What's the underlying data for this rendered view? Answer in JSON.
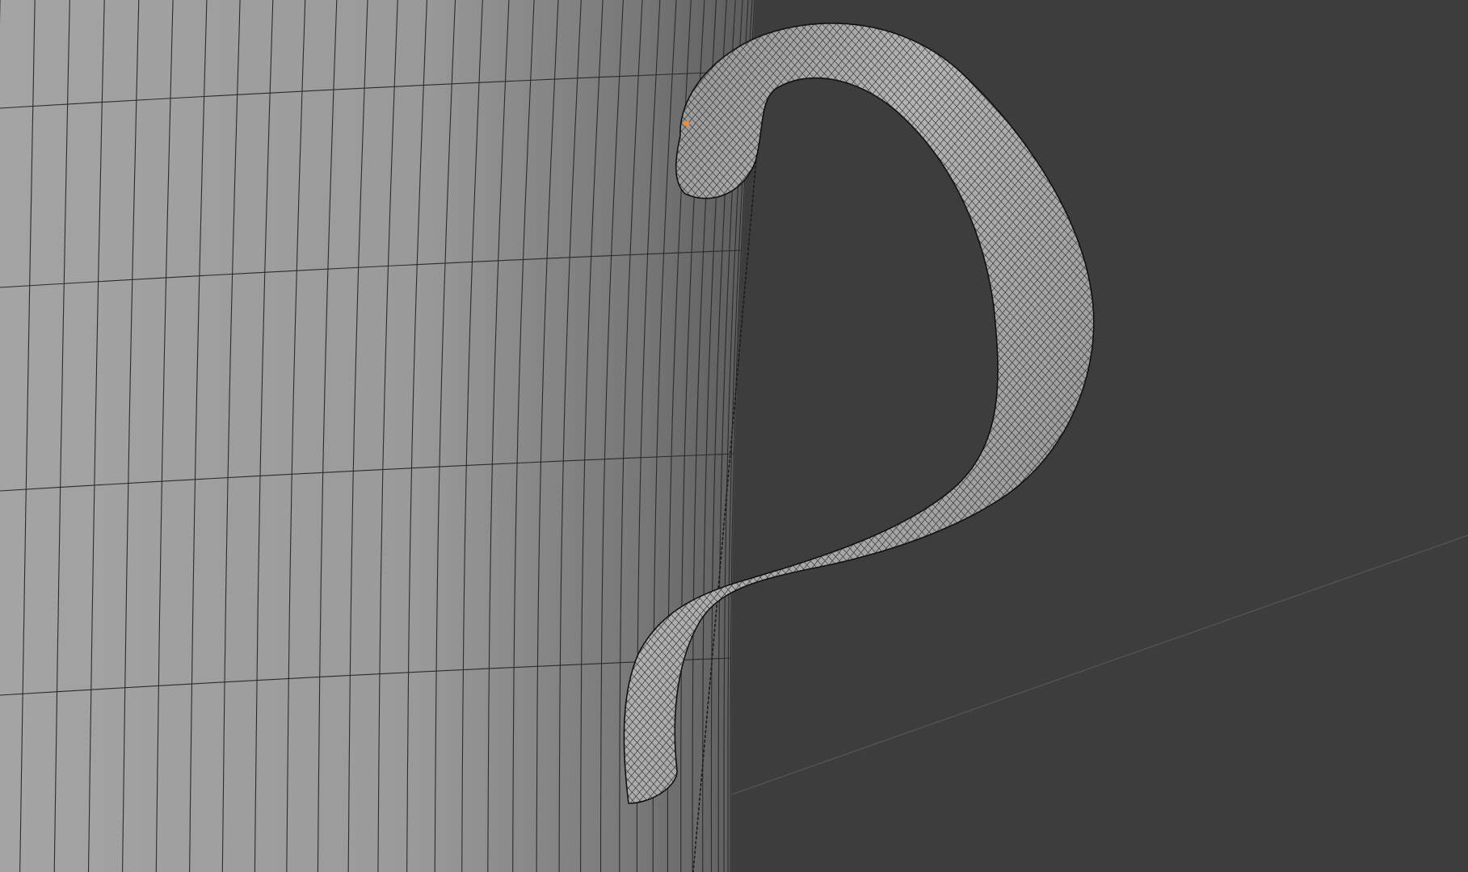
{
  "viewport": {
    "background_color": "#3d3d3d",
    "grid_line_color": "#565656"
  },
  "mug_body": {
    "fill_light": "#a7a7a7",
    "fill_shadow": "#5c5c5c",
    "wire_color": "#2b2b2b"
  },
  "mug_handle": {
    "fill_light": "#b2b2b2",
    "fill_shadow": "#6a6a6a",
    "wire_color": "#262626",
    "outline_color": "#111111"
  },
  "selected_vertex_color": "#ff8a1e"
}
